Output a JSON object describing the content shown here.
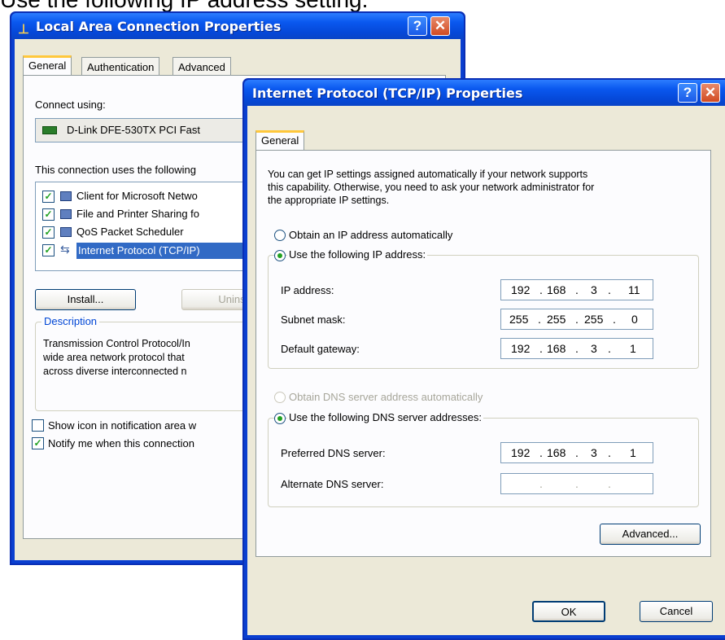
{
  "caption": "Use the following IP address setting.",
  "lan_window": {
    "title": "Local Area Connection Properties",
    "help": "?",
    "close": "✕",
    "tabs": [
      "General",
      "Authentication",
      "Advanced"
    ],
    "connect_using_label": "Connect using:",
    "adapter": "D-Link DFE-530TX PCI Fast",
    "components_label": "This connection uses the following",
    "components": [
      "Client for Microsoft Netwo",
      "File and Printer Sharing fo",
      "QoS Packet Scheduler",
      "Internet Protocol (TCP/IP)"
    ],
    "install_button": "Install...",
    "uninstall_button": "Unins",
    "description_label": "Description",
    "description_lines": [
      "Transmission Control Protocol/In",
      "wide area network protocol that",
      "across diverse interconnected n"
    ],
    "show_icon_label": "Show icon in notification area w",
    "notify_label": "Notify me when this connection"
  },
  "tcpip_window": {
    "title": "Internet Protocol (TCP/IP) Properties",
    "help": "?",
    "close": "✕",
    "tab": "General",
    "intro_lines": [
      "You can get IP settings assigned automatically if your network supports",
      "this capability. Otherwise, you need to ask your network administrator for",
      "the appropriate IP settings."
    ],
    "obtain_ip_auto": "Obtain an IP address automatically",
    "use_following_ip": "Use the following IP address:",
    "ip_address_label": "IP address:",
    "ip_address": [
      "192",
      "168",
      "3",
      "11"
    ],
    "subnet_mask_label": "Subnet mask:",
    "subnet_mask": [
      "255",
      "255",
      "255",
      "0"
    ],
    "default_gateway_label": "Default gateway:",
    "default_gateway": [
      "192",
      "168",
      "3",
      "1"
    ],
    "obtain_dns_auto": "Obtain DNS server address automatically",
    "use_following_dns": "Use the following DNS server addresses:",
    "preferred_dns_label": "Preferred DNS server:",
    "preferred_dns": [
      "192",
      "168",
      "3",
      "1"
    ],
    "alternate_dns_label": "Alternate DNS server:",
    "alternate_dns": [
      "",
      "",
      "",
      ""
    ],
    "dot": ".",
    "advanced_button": "Advanced...",
    "ok_button": "OK",
    "cancel_button": "Cancel"
  }
}
